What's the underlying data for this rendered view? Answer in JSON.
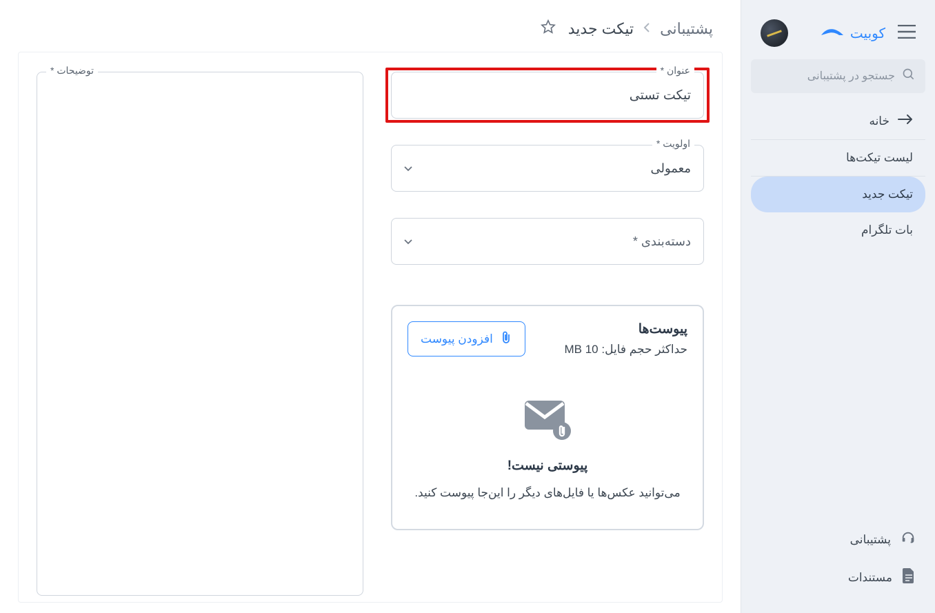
{
  "brand": {
    "name": "کوبیت"
  },
  "search": {
    "placeholder": "جستجو در پشتیبانی"
  },
  "nav": {
    "home": "خانه",
    "items": [
      {
        "label": "لیست تیکت‌ها"
      },
      {
        "label": "تیکت جدید"
      },
      {
        "label": "بات تلگرام"
      }
    ]
  },
  "footer": {
    "support": "پشتیبانی",
    "docs": "مستندات"
  },
  "breadcrumb": {
    "parent": "پشتیبانی",
    "current": "تیکت جدید"
  },
  "form": {
    "title_label": "عنوان *",
    "title_value": "تیکت تستی",
    "priority_label": "اولویت *",
    "priority_value": "معمولی",
    "category_label": "دسته‌بندی *",
    "category_value": "",
    "description_label": "توضیحات *"
  },
  "attachments": {
    "title": "پیوست‌ها",
    "max_size": "حداکثر حجم فایل: 10 MB",
    "button": "افزودن پیوست",
    "empty": "پیوستی نیست!",
    "hint": "می‌توانید عکس‌ها یا فایل‌های دیگر را این‌جا پیوست کنید."
  }
}
